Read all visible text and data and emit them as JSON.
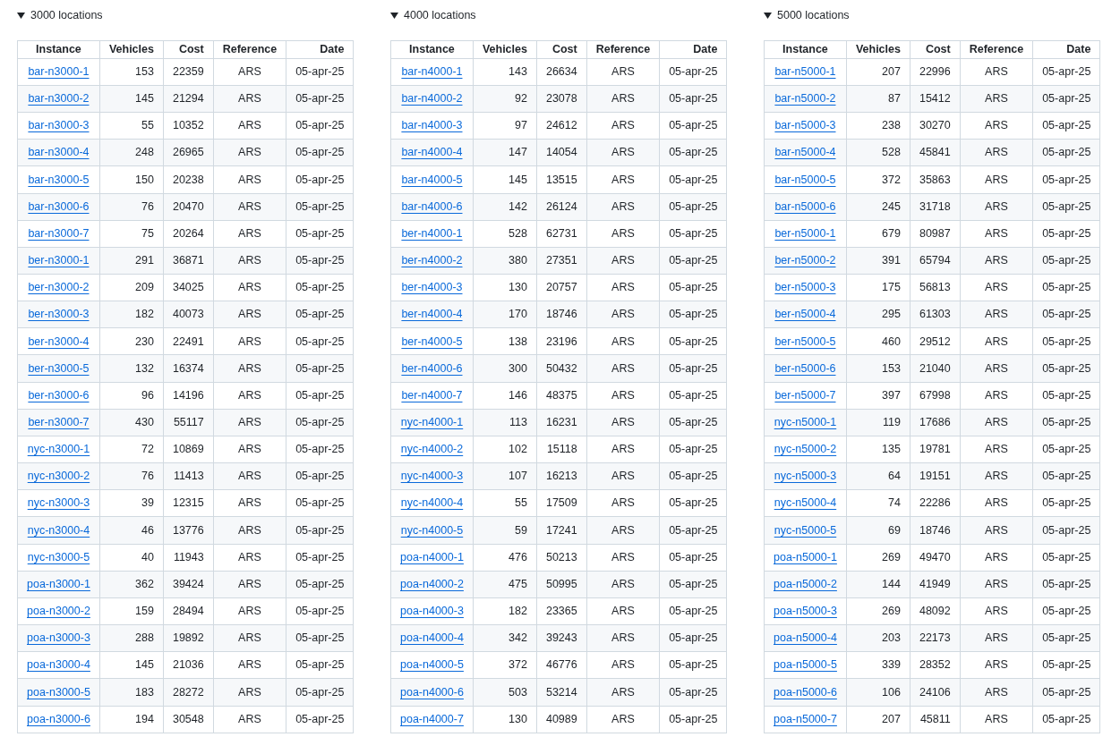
{
  "sections": [
    {
      "title": "3000 locations",
      "expanded": true,
      "columns": [
        "Instance",
        "Vehicles",
        "Cost",
        "Reference",
        "Date"
      ],
      "rows": [
        [
          "bar-n3000-1",
          "153",
          "22359",
          "ARS",
          "05-apr-25"
        ],
        [
          "bar-n3000-2",
          "145",
          "21294",
          "ARS",
          "05-apr-25"
        ],
        [
          "bar-n3000-3",
          "55",
          "10352",
          "ARS",
          "05-apr-25"
        ],
        [
          "bar-n3000-4",
          "248",
          "26965",
          "ARS",
          "05-apr-25"
        ],
        [
          "bar-n3000-5",
          "150",
          "20238",
          "ARS",
          "05-apr-25"
        ],
        [
          "bar-n3000-6",
          "76",
          "20470",
          "ARS",
          "05-apr-25"
        ],
        [
          "bar-n3000-7",
          "75",
          "20264",
          "ARS",
          "05-apr-25"
        ],
        [
          "ber-n3000-1",
          "291",
          "36871",
          "ARS",
          "05-apr-25"
        ],
        [
          "ber-n3000-2",
          "209",
          "34025",
          "ARS",
          "05-apr-25"
        ],
        [
          "ber-n3000-3",
          "182",
          "40073",
          "ARS",
          "05-apr-25"
        ],
        [
          "ber-n3000-4",
          "230",
          "22491",
          "ARS",
          "05-apr-25"
        ],
        [
          "ber-n3000-5",
          "132",
          "16374",
          "ARS",
          "05-apr-25"
        ],
        [
          "ber-n3000-6",
          "96",
          "14196",
          "ARS",
          "05-apr-25"
        ],
        [
          "ber-n3000-7",
          "430",
          "55117",
          "ARS",
          "05-apr-25"
        ],
        [
          "nyc-n3000-1",
          "72",
          "10869",
          "ARS",
          "05-apr-25"
        ],
        [
          "nyc-n3000-2",
          "76",
          "11413",
          "ARS",
          "05-apr-25"
        ],
        [
          "nyc-n3000-3",
          "39",
          "12315",
          "ARS",
          "05-apr-25"
        ],
        [
          "nyc-n3000-4",
          "46",
          "13776",
          "ARS",
          "05-apr-25"
        ],
        [
          "nyc-n3000-5",
          "40",
          "11943",
          "ARS",
          "05-apr-25"
        ],
        [
          "poa-n3000-1",
          "362",
          "39424",
          "ARS",
          "05-apr-25"
        ],
        [
          "poa-n3000-2",
          "159",
          "28494",
          "ARS",
          "05-apr-25"
        ],
        [
          "poa-n3000-3",
          "288",
          "19892",
          "ARS",
          "05-apr-25"
        ],
        [
          "poa-n3000-4",
          "145",
          "21036",
          "ARS",
          "05-apr-25"
        ],
        [
          "poa-n3000-5",
          "183",
          "28272",
          "ARS",
          "05-apr-25"
        ],
        [
          "poa-n3000-6",
          "194",
          "30548",
          "ARS",
          "05-apr-25"
        ]
      ]
    },
    {
      "title": "4000 locations",
      "expanded": true,
      "columns": [
        "Instance",
        "Vehicles",
        "Cost",
        "Reference",
        "Date"
      ],
      "rows": [
        [
          "bar-n4000-1",
          "143",
          "26634",
          "ARS",
          "05-apr-25"
        ],
        [
          "bar-n4000-2",
          "92",
          "23078",
          "ARS",
          "05-apr-25"
        ],
        [
          "bar-n4000-3",
          "97",
          "24612",
          "ARS",
          "05-apr-25"
        ],
        [
          "bar-n4000-4",
          "147",
          "14054",
          "ARS",
          "05-apr-25"
        ],
        [
          "bar-n4000-5",
          "145",
          "13515",
          "ARS",
          "05-apr-25"
        ],
        [
          "bar-n4000-6",
          "142",
          "26124",
          "ARS",
          "05-apr-25"
        ],
        [
          "ber-n4000-1",
          "528",
          "62731",
          "ARS",
          "05-apr-25"
        ],
        [
          "ber-n4000-2",
          "380",
          "27351",
          "ARS",
          "05-apr-25"
        ],
        [
          "ber-n4000-3",
          "130",
          "20757",
          "ARS",
          "05-apr-25"
        ],
        [
          "ber-n4000-4",
          "170",
          "18746",
          "ARS",
          "05-apr-25"
        ],
        [
          "ber-n4000-5",
          "138",
          "23196",
          "ARS",
          "05-apr-25"
        ],
        [
          "ber-n4000-6",
          "300",
          "50432",
          "ARS",
          "05-apr-25"
        ],
        [
          "ber-n4000-7",
          "146",
          "48375",
          "ARS",
          "05-apr-25"
        ],
        [
          "nyc-n4000-1",
          "113",
          "16231",
          "ARS",
          "05-apr-25"
        ],
        [
          "nyc-n4000-2",
          "102",
          "15118",
          "ARS",
          "05-apr-25"
        ],
        [
          "nyc-n4000-3",
          "107",
          "16213",
          "ARS",
          "05-apr-25"
        ],
        [
          "nyc-n4000-4",
          "55",
          "17509",
          "ARS",
          "05-apr-25"
        ],
        [
          "nyc-n4000-5",
          "59",
          "17241",
          "ARS",
          "05-apr-25"
        ],
        [
          "poa-n4000-1",
          "476",
          "50213",
          "ARS",
          "05-apr-25"
        ],
        [
          "poa-n4000-2",
          "475",
          "50995",
          "ARS",
          "05-apr-25"
        ],
        [
          "poa-n4000-3",
          "182",
          "23365",
          "ARS",
          "05-apr-25"
        ],
        [
          "poa-n4000-4",
          "342",
          "39243",
          "ARS",
          "05-apr-25"
        ],
        [
          "poa-n4000-5",
          "372",
          "46776",
          "ARS",
          "05-apr-25"
        ],
        [
          "poa-n4000-6",
          "503",
          "53214",
          "ARS",
          "05-apr-25"
        ],
        [
          "poa-n4000-7",
          "130",
          "40989",
          "ARS",
          "05-apr-25"
        ]
      ]
    },
    {
      "title": "5000 locations",
      "expanded": true,
      "columns": [
        "Instance",
        "Vehicles",
        "Cost",
        "Reference",
        "Date"
      ],
      "rows": [
        [
          "bar-n5000-1",
          "207",
          "22996",
          "ARS",
          "05-apr-25"
        ],
        [
          "bar-n5000-2",
          "87",
          "15412",
          "ARS",
          "05-apr-25"
        ],
        [
          "bar-n5000-3",
          "238",
          "30270",
          "ARS",
          "05-apr-25"
        ],
        [
          "bar-n5000-4",
          "528",
          "45841",
          "ARS",
          "05-apr-25"
        ],
        [
          "bar-n5000-5",
          "372",
          "35863",
          "ARS",
          "05-apr-25"
        ],
        [
          "bar-n5000-6",
          "245",
          "31718",
          "ARS",
          "05-apr-25"
        ],
        [
          "ber-n5000-1",
          "679",
          "80987",
          "ARS",
          "05-apr-25"
        ],
        [
          "ber-n5000-2",
          "391",
          "65794",
          "ARS",
          "05-apr-25"
        ],
        [
          "ber-n5000-3",
          "175",
          "56813",
          "ARS",
          "05-apr-25"
        ],
        [
          "ber-n5000-4",
          "295",
          "61303",
          "ARS",
          "05-apr-25"
        ],
        [
          "ber-n5000-5",
          "460",
          "29512",
          "ARS",
          "05-apr-25"
        ],
        [
          "ber-n5000-6",
          "153",
          "21040",
          "ARS",
          "05-apr-25"
        ],
        [
          "ber-n5000-7",
          "397",
          "67998",
          "ARS",
          "05-apr-25"
        ],
        [
          "nyc-n5000-1",
          "119",
          "17686",
          "ARS",
          "05-apr-25"
        ],
        [
          "nyc-n5000-2",
          "135",
          "19781",
          "ARS",
          "05-apr-25"
        ],
        [
          "nyc-n5000-3",
          "64",
          "19151",
          "ARS",
          "05-apr-25"
        ],
        [
          "nyc-n5000-4",
          "74",
          "22286",
          "ARS",
          "05-apr-25"
        ],
        [
          "nyc-n5000-5",
          "69",
          "18746",
          "ARS",
          "05-apr-25"
        ],
        [
          "poa-n5000-1",
          "269",
          "49470",
          "ARS",
          "05-apr-25"
        ],
        [
          "poa-n5000-2",
          "144",
          "41949",
          "ARS",
          "05-apr-25"
        ],
        [
          "poa-n5000-3",
          "269",
          "48092",
          "ARS",
          "05-apr-25"
        ],
        [
          "poa-n5000-4",
          "203",
          "22173",
          "ARS",
          "05-apr-25"
        ],
        [
          "poa-n5000-5",
          "339",
          "28352",
          "ARS",
          "05-apr-25"
        ],
        [
          "poa-n5000-6",
          "106",
          "24106",
          "ARS",
          "05-apr-25"
        ],
        [
          "poa-n5000-7",
          "207",
          "45811",
          "ARS",
          "05-apr-25"
        ]
      ]
    }
  ]
}
